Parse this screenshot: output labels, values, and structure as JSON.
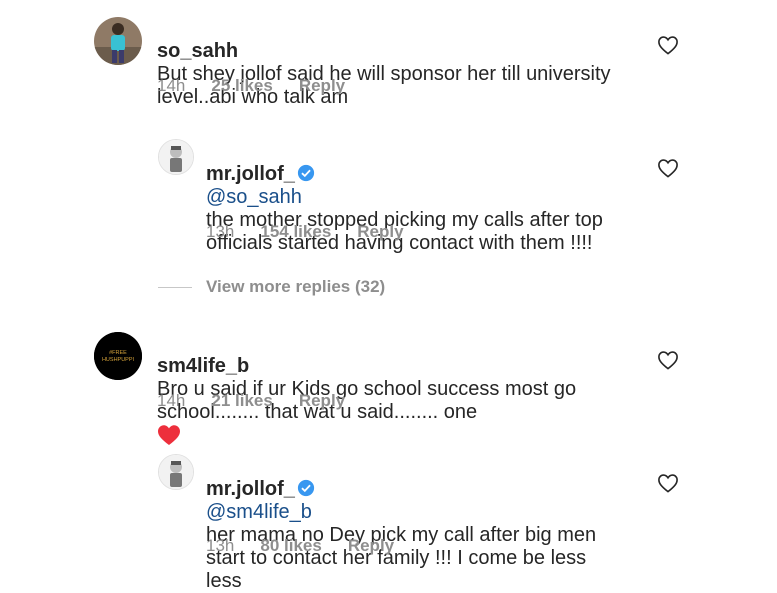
{
  "comments": [
    {
      "username": "so_sahh",
      "text": "But shey jollof said he will sponsor her till university level..abi who talk am",
      "time": "14h",
      "likes": "25 likes",
      "reply_label": "Reply"
    },
    {
      "username": "mr.jollof_",
      "mention": "@so_sahh",
      "text": "the mother stopped picking my calls after top officials started having contact with them !!!!",
      "time": "13h",
      "likes": "154 likes",
      "reply_label": "Reply"
    },
    {
      "username": "sm4life_b",
      "text": "Bro u said if ur Kids go school success most go school........ that wat u said........ one",
      "time": "14h",
      "likes": "21 likes",
      "reply_label": "Reply",
      "avatar_text": "#FREE HUSHPUPPI"
    },
    {
      "username": "mr.jollof_",
      "mention": "@sm4life_b",
      "text": "her mama no Dey pick my call after big men start to contact her family !!! I come be less less",
      "time": "13h",
      "likes": "80 likes",
      "reply_label": "Reply"
    }
  ],
  "view_more": "View more replies (32)",
  "colors": {
    "text": "#262626",
    "meta": "#8e8e8e",
    "mention": "#1a4f8a",
    "verified": "#3897f0",
    "heart_red": "#ed2f3c"
  }
}
